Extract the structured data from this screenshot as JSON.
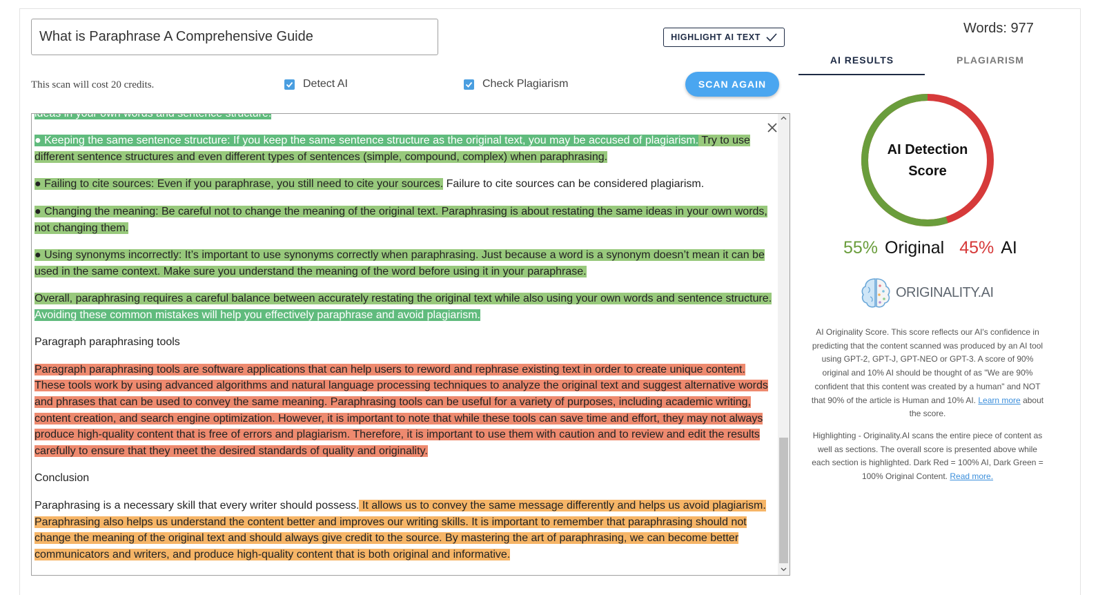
{
  "document": {
    "title": "What is Paraphrase A Comprehensive Guide",
    "highlight_button": "HIGHLIGHT AI TEXT",
    "cost_text": "This scan will cost 20 credits.",
    "detect_ai_label": "Detect AI",
    "check_plagiarism_label": "Check Plagiarism",
    "scan_again_button": "SCAN AGAIN"
  },
  "editor": {
    "top_cut": "ideas in your own words and sentence structure.",
    "p1_a": "●      Keeping the same sentence structure: If you keep the same sentence structure as the original text, you may be accused of plagiarism.",
    "p1_b": " Try to use different sentence structures and even different types of sentences (simple, compound, complex) when paraphrasing.",
    "p2_a": "●      Failing to cite sources: Even if you paraphrase, you still need to cite your sources.",
    "p2_b": " Failure to cite sources can be considered plagiarism.",
    "p3": "●      Changing the meaning: Be careful not to change the meaning of the original text. Paraphrasing is about restating the same ideas in your own words, not changing them.",
    "p4": "●      Using synonyms incorrectly: It’s important to use synonyms correctly when paraphrasing. Just because a word is a synonym doesn’t mean it can be used in the same context. Make sure you understand the meaning of the word before using it in your paraphrase.",
    "p5_a": "Overall, paraphrasing requires a careful balance between accurately restating the original text while also using your own words and sentence structure.",
    "p5_b": " Avoiding these common mistakes will help you effectively paraphrase and avoid plagiarism.",
    "h1": "Paragraph paraphrasing tools",
    "p6": "Paragraph paraphrasing tools are software applications that can help users to reword and rephrase existing text in order to create unique content. These tools work by using advanced algorithms and natural language processing techniques to analyze the original text and suggest alternative words and phrases that can be used to convey the same meaning. Paraphrasing tools can be useful for a variety of purposes, including academic writing, content creation, and search engine optimization. However, it is important to note that while these tools can save time and effort, they may not always produce high-quality content that is free of errors and plagiarism. Therefore, it is important to use them with caution and to review and edit the results carefully to ensure that they meet the desired standards of quality and originality.",
    "h2": "Conclusion",
    "p7_a": "Paraphrasing is a necessary skill that every writer should possess.",
    "p7_b": " It allows us to convey the same message differently and helps us avoid plagiarism. Paraphrasing also helps us understand the content better and improves our writing skills. It is important to remember that paraphrasing should not change the meaning of the original text and should always give credit to the source. By mastering the art of paraphrasing, we can become better communicators and writers, and produce high-quality content that is both original and informative."
  },
  "results": {
    "words": "Words: 977",
    "tab_ai": "AI RESULTS",
    "tab_plagiarism": "PLAGIARISM",
    "gauge_line1": "AI Detection",
    "gauge_line2": "Score",
    "original_fraction": 0.55,
    "original_pct": "55%",
    "original_label": "Original",
    "ai_pct": "45%",
    "ai_label": "AI",
    "logo_text": "ORIGINALITY.AI",
    "desc1": "AI Originality Score. This score reflects our AI's confidence in predicting that the content scanned was produced by an AI tool using GPT-2, GPT-J, GPT-NEO or GPT-3. A score of 90% original and 10% AI should be thought of as \"We are 90% confident that this content was created by a human\" and NOT that 90% of the article is Human and 10% AI.",
    "desc1_link": "Learn more",
    "desc1_tail": " about the score.",
    "desc2": "Highlighting - Originality.AI scans the entire piece of content as well as sections. The overall score is presented above while each section is highlighted. Dark Red = 100% AI, Dark Green = 100% Original Content.",
    "desc2_link": "Read more."
  },
  "colors": {
    "original_green": "#6a9d3c",
    "ai_red": "#d63a3a",
    "highlight_green": "#98c97c",
    "highlight_dark_green": "#60bb7d",
    "highlight_red": "#ee8a6f",
    "highlight_orange": "#f6b567",
    "accent_blue": "#4aa6f0"
  }
}
